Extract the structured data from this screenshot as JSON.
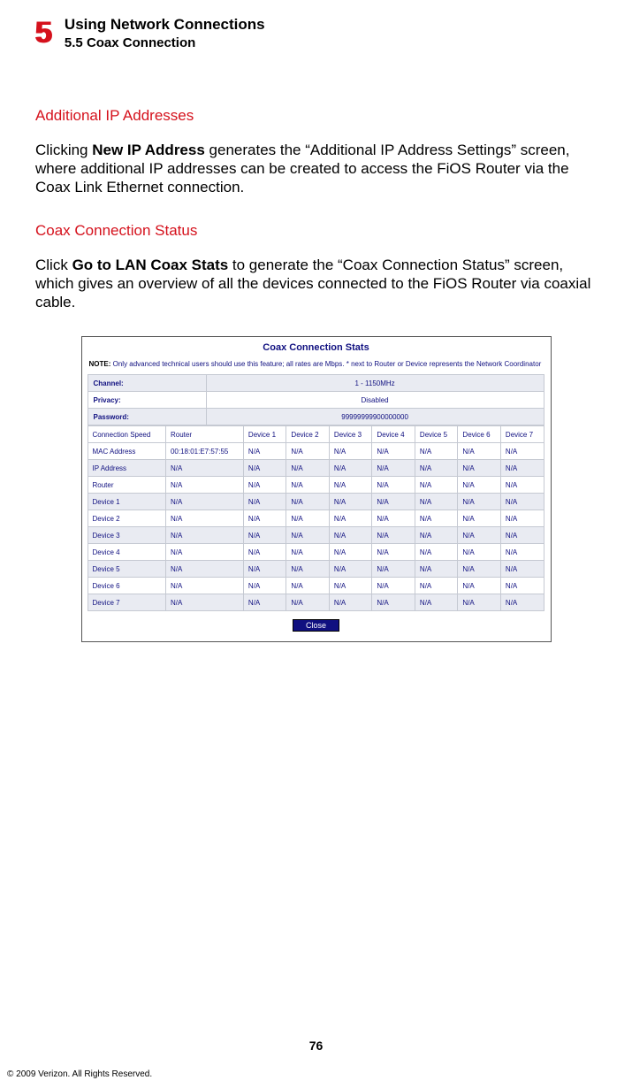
{
  "header": {
    "chapter_number": "5",
    "title": "Using Network Connections",
    "subsection": "5.5  Coax Connection"
  },
  "section1": {
    "heading": "Additional IP Addresses",
    "para_pre": "Clicking ",
    "para_bold": "New IP Address",
    "para_post": " generates the “Additional IP Address Settings” screen, where additional IP addresses can be created to access the FiOS Router via the Coax Link Ethernet connection."
  },
  "section2": {
    "heading": "Coax Connection Status",
    "para_pre": "Click ",
    "para_bold": "Go to LAN Coax Stats",
    "para_post": " to generate the “Coax Connection Status” screen, which gives an overview of all the devices connected to the FiOS Router via coaxial cable."
  },
  "stats": {
    "title": "Coax Connection Stats",
    "note_label": "NOTE:",
    "note_text": " Only advanced technical users should use this feature; all rates are Mbps. * next to Router or Device represents the Network Coordinator",
    "kv": [
      {
        "k": "Channel:",
        "v": "1 - 1150MHz"
      },
      {
        "k": "Privacy:",
        "v": "Disabled"
      },
      {
        "k": "Password:",
        "v": "99999999900000000"
      }
    ],
    "columns": [
      "Connection Speed",
      "Router",
      "Device 1",
      "Device 2",
      "Device 3",
      "Device 4",
      "Device 5",
      "Device 6",
      "Device 7"
    ],
    "rows": [
      {
        "label": "MAC Address",
        "router": "00:18:01:E7:57:55",
        "cells": [
          "N/A",
          "N/A",
          "N/A",
          "N/A",
          "N/A",
          "N/A",
          "N/A"
        ]
      },
      {
        "label": "IP Address",
        "router": "N/A",
        "cells": [
          "N/A",
          "N/A",
          "N/A",
          "N/A",
          "N/A",
          "N/A",
          "N/A"
        ]
      },
      {
        "label": "Router",
        "router": "N/A",
        "cells": [
          "N/A",
          "N/A",
          "N/A",
          "N/A",
          "N/A",
          "N/A",
          "N/A"
        ]
      },
      {
        "label": "Device 1",
        "router": "N/A",
        "cells": [
          "N/A",
          "N/A",
          "N/A",
          "N/A",
          "N/A",
          "N/A",
          "N/A"
        ]
      },
      {
        "label": "Device 2",
        "router": "N/A",
        "cells": [
          "N/A",
          "N/A",
          "N/A",
          "N/A",
          "N/A",
          "N/A",
          "N/A"
        ]
      },
      {
        "label": "Device 3",
        "router": "N/A",
        "cells": [
          "N/A",
          "N/A",
          "N/A",
          "N/A",
          "N/A",
          "N/A",
          "N/A"
        ]
      },
      {
        "label": "Device 4",
        "router": "N/A",
        "cells": [
          "N/A",
          "N/A",
          "N/A",
          "N/A",
          "N/A",
          "N/A",
          "N/A"
        ]
      },
      {
        "label": "Device 5",
        "router": "N/A",
        "cells": [
          "N/A",
          "N/A",
          "N/A",
          "N/A",
          "N/A",
          "N/A",
          "N/A"
        ]
      },
      {
        "label": "Device 6",
        "router": "N/A",
        "cells": [
          "N/A",
          "N/A",
          "N/A",
          "N/A",
          "N/A",
          "N/A",
          "N/A"
        ]
      },
      {
        "label": "Device 7",
        "router": "N/A",
        "cells": [
          "N/A",
          "N/A",
          "N/A",
          "N/A",
          "N/A",
          "N/A",
          "N/A"
        ]
      }
    ],
    "close_label": "Close"
  },
  "footer": {
    "page_number": "76",
    "copyright": "© 2009 Verizon. All Rights Reserved."
  }
}
